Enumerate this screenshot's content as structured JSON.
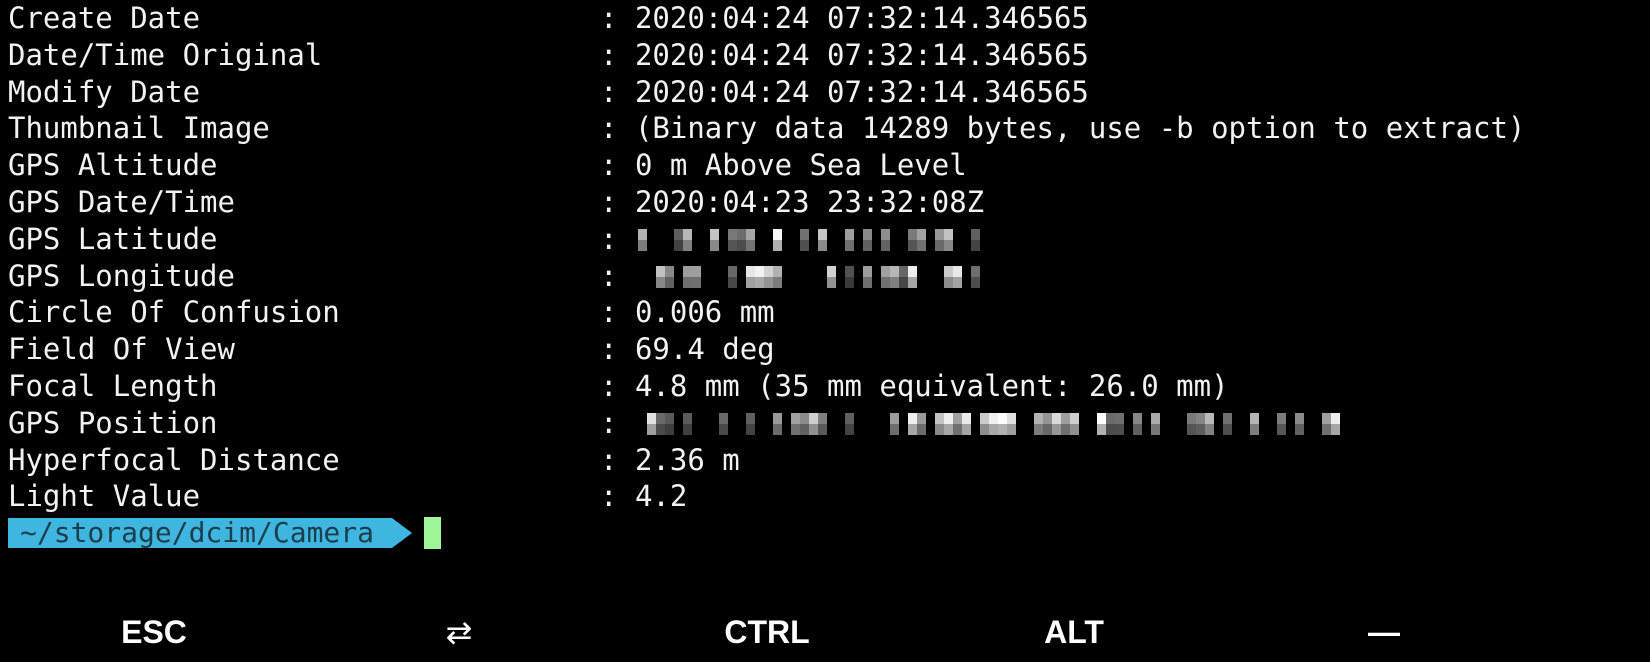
{
  "terminal": {
    "separator": ":",
    "rows": [
      {
        "key": "Create Date",
        "value": "2020:04:24 07:32:14.346565"
      },
      {
        "key": "Date/Time Original",
        "value": "2020:04:24 07:32:14.346565"
      },
      {
        "key": "Modify Date",
        "value": "2020:04:24 07:32:14.346565"
      },
      {
        "key": "Thumbnail Image",
        "value": "(Binary data 14289 bytes, use -b option to extract)"
      },
      {
        "key": "GPS Altitude",
        "value": "0 m Above Sea Level"
      },
      {
        "key": "GPS Date/Time",
        "value": "2020:04:23 23:32:08Z"
      },
      {
        "key": "GPS Latitude",
        "value": null,
        "redacted": true
      },
      {
        "key": "GPS Longitude",
        "value": null,
        "redacted": true
      },
      {
        "key": "Circle Of Confusion",
        "value": "0.006 mm"
      },
      {
        "key": "Field Of View",
        "value": "69.4 deg"
      },
      {
        "key": "Focal Length",
        "value": "4.8 mm (35 mm equivalent: 26.0 mm)"
      },
      {
        "key": "GPS Position",
        "value": null,
        "redacted": true
      },
      {
        "key": "Hyperfocal Distance",
        "value": "2.36 m"
      },
      {
        "key": "Light Value",
        "value": "4.2"
      }
    ],
    "prompt_path": "~/storage/dcim/Camera",
    "prompt_color": "#3fb6e0",
    "cursor_color": "#9ef59a"
  },
  "extra_keys": {
    "esc": "ESC",
    "tab_icon": "tab-arrows-icon",
    "tab": "⇄",
    "ctrl": "CTRL",
    "alt": "ALT",
    "dash": "—"
  }
}
